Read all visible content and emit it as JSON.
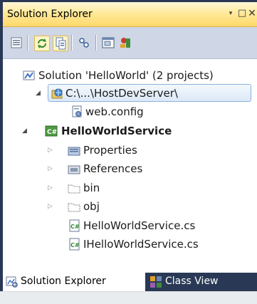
{
  "window": {
    "title": "Solution Explorer"
  },
  "window_controls": {
    "dropdown": "▾",
    "maximize": "□",
    "close": "✕"
  },
  "toolbar": {
    "icons": [
      "properties-icon",
      "refresh-icon",
      "show-all-files-icon",
      "nest-related-files-icon",
      "view-designer-icon",
      "view-class-diagram-icon"
    ]
  },
  "tree": {
    "items": [
      {
        "label": "Solution 'HelloWorld' (2 projects)",
        "icon": "solution-icon",
        "expander": ""
      },
      {
        "label": "C:\\...\\HostDevServer\\",
        "icon": "website-project-icon",
        "expander": "◢"
      },
      {
        "label": "web.config",
        "icon": "config-file-icon",
        "expander": ""
      },
      {
        "label": "HelloWorldService",
        "icon": "csharp-project-icon",
        "expander": "◢"
      },
      {
        "label": "Properties",
        "icon": "properties-folder-icon",
        "expander": "▷"
      },
      {
        "label": "References",
        "icon": "references-icon",
        "expander": "▷"
      },
      {
        "label": "bin",
        "icon": "folder-icon",
        "expander": "▷"
      },
      {
        "label": "obj",
        "icon": "folder-icon",
        "expander": "▷"
      },
      {
        "label": "HelloWorldService.cs",
        "icon": "csharp-file-icon",
        "expander": ""
      },
      {
        "label": "IHelloWorldService.cs",
        "icon": "csharp-file-icon",
        "expander": ""
      }
    ]
  },
  "tabs": [
    {
      "label": "Solution Explorer",
      "icon": "solution-explorer-icon",
      "active": true
    },
    {
      "label": "Class View",
      "icon": "class-view-icon",
      "active": false
    }
  ],
  "colors": {
    "frame": "#293955",
    "title_gradient_top": "#fff8d8",
    "title_gradient_bottom": "#ffd86a",
    "toolbar": "#cfd6e5",
    "selection_border": "#8cb0dd"
  }
}
